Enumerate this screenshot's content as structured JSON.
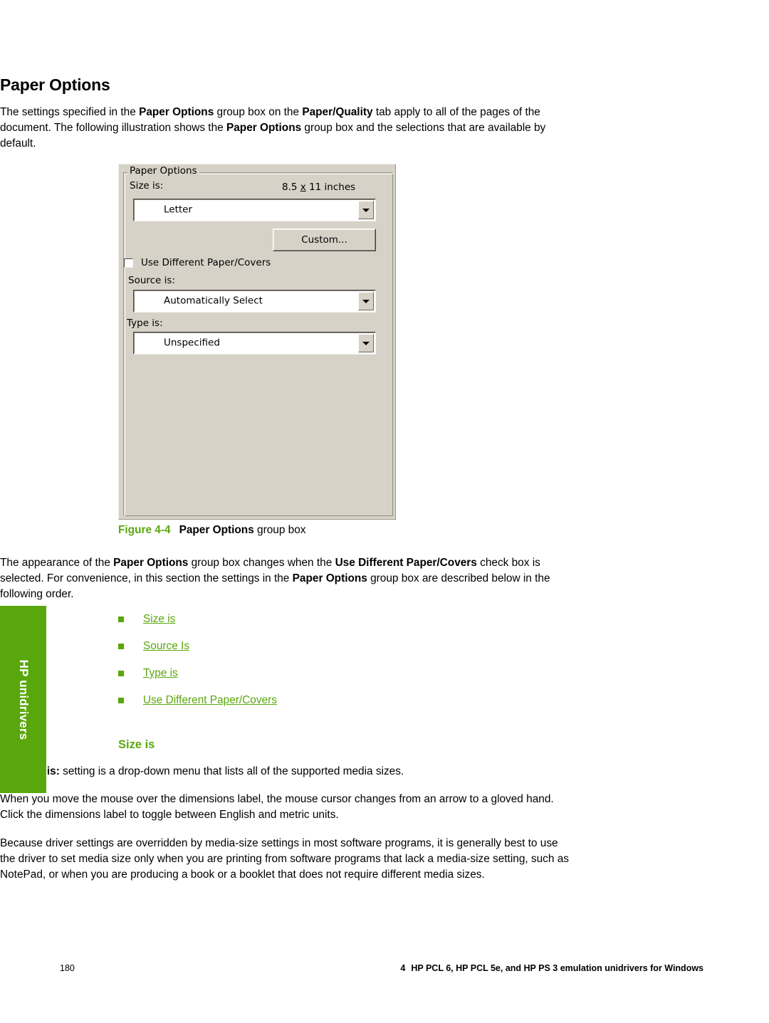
{
  "page": {
    "section_title": "Paper Options",
    "intro_paragraph": {
      "segments": [
        {
          "text": "The settings specified in the ",
          "bold": false
        },
        {
          "text": "Paper Options",
          "bold": true
        },
        {
          "text": " group box on the ",
          "bold": false
        },
        {
          "text": "Paper/Quality",
          "bold": true
        },
        {
          "text": " tab apply to all of the pages of the document. The following illustration shows the ",
          "bold": false
        },
        {
          "text": "Paper Options",
          "bold": true
        },
        {
          "text": " group box and the selections that are available by default.",
          "bold": false
        }
      ],
      "plain": "The settings specified in the Paper Options group box on the Paper/Quality tab apply to all of the pages of the document. The following illustration shows the Paper Options group box and the selections that are available by default."
    },
    "second_paragraph": {
      "plain": "The appearance of the Paper Options group box changes when the Use Different Paper/Covers check box is selected. For convenience, in this section the settings in the Paper Options group box are described below in the following order."
    },
    "sub_heading": "Size is",
    "paragraph_size_is": {
      "plain": "The Size is: setting is a drop-down menu that lists all of the supported media sizes."
    },
    "paragraph_mouse": "When you move the mouse over the dimensions label, the mouse cursor changes from an arrow to a gloved hand. Click the dimensions label to toggle between English and metric units.",
    "paragraph_driver": "Because driver settings are overridden by media-size settings in most software programs, it is generally best to use the driver to set media size only when you are printing from software programs that lack a media-size setting, such as NotePad, or when you are producing a book or a booklet that does not require different media sizes."
  },
  "figure": {
    "caption_number": "Figure 4-4",
    "caption_bold": "Paper Options",
    "caption_rest": " group box"
  },
  "dialog": {
    "group_legend": "Paper Options",
    "size_label": "Size is:",
    "dimensions": {
      "value": "8.5",
      "separator": "x",
      "rest": "11 inches"
    },
    "size_combo_value": "Letter",
    "custom_button": "Custom...",
    "use_different_checkbox": {
      "label": "Use Different Paper/Covers",
      "checked": false
    },
    "source_label": "Source is:",
    "source_combo_value": "Automatically Select",
    "type_label": "Type is:",
    "type_combo_value": "Unspecified",
    "icons": {
      "size_dropdown": "chevron-down-icon",
      "source_dropdown": "chevron-down-icon",
      "type_dropdown": "chevron-down-icon"
    }
  },
  "links": [
    {
      "label": "Size is"
    },
    {
      "label": "Source Is"
    },
    {
      "label": "Type is"
    },
    {
      "label": "Use Different Paper/Covers"
    }
  ],
  "side_tab": {
    "label": "HP unidrivers"
  },
  "footer": {
    "page_number": "180",
    "chapter_number": "4",
    "chapter_title": "HP PCL 6, HP PCL 5e, and HP PS 3 emulation unidrivers for Windows"
  },
  "colors": {
    "brand_green": "#5aa70d",
    "dialog_face": "#d6d2c8",
    "text": "#000000"
  }
}
